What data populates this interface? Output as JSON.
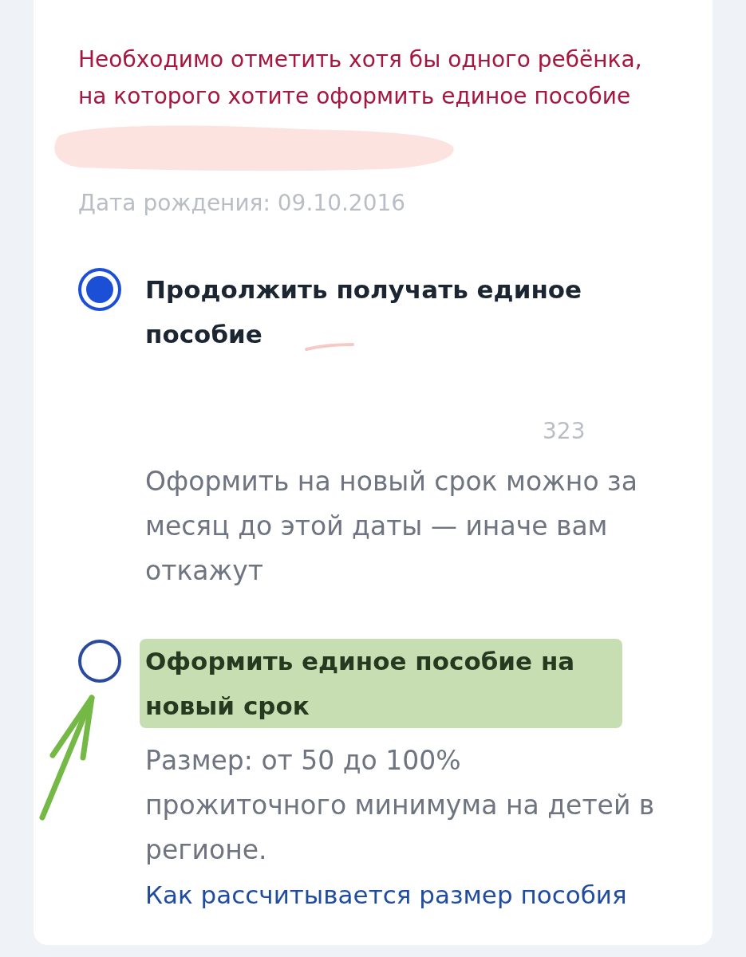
{
  "error_message": "Необходимо отметить хотя бы одного ребёнка, на которого хотите оформить единое пособие",
  "child": {
    "name_redacted": true,
    "birth_date": "Дата рождения: 09.10.2016"
  },
  "options": [
    {
      "label": "Продолжить получать единое пособие",
      "selected": true,
      "highlighted": false,
      "arrow": false,
      "faded_text": "323",
      "note": "Оформить на новый срок можно за месяц до этой даты — иначе вам откажут"
    },
    {
      "label": "Оформить единое пособие на новый срок",
      "selected": false,
      "highlighted": true,
      "arrow": true,
      "description": "Размер: от 50 до 100% прожиточного минимума на детей в регионе.",
      "link": "Как рассчитывается размер пособия"
    }
  ]
}
